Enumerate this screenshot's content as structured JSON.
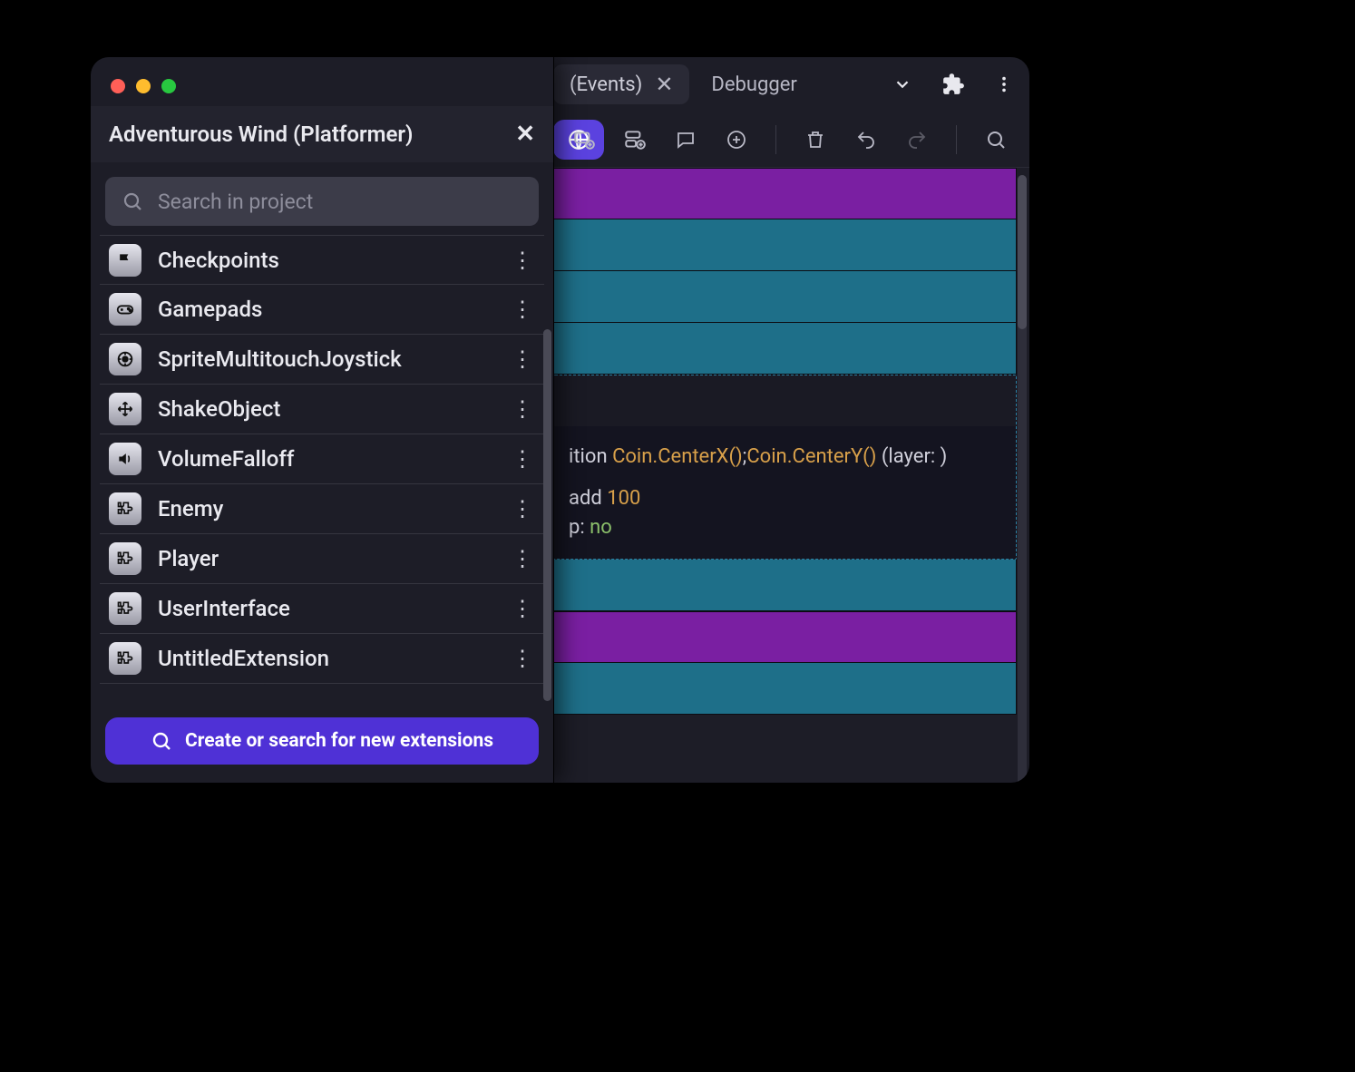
{
  "tabs": {
    "events_label": "(Events)",
    "debugger_label": "Debugger"
  },
  "panel": {
    "title": "Adventurous Wind (Platformer)",
    "search_placeholder": "Search in project",
    "cta_label": "Create or search for new extensions",
    "items": [
      {
        "label": "Checkpoints",
        "icon": "flag-icon"
      },
      {
        "label": "Gamepads",
        "icon": "gamepad-icon"
      },
      {
        "label": "SpriteMultitouchJoystick",
        "icon": "joystick-icon"
      },
      {
        "label": "ShakeObject",
        "icon": "move-icon"
      },
      {
        "label": "VolumeFalloff",
        "icon": "volume-icon"
      },
      {
        "label": "Enemy",
        "icon": "puzzle-icon"
      },
      {
        "label": "Player",
        "icon": "puzzle-icon"
      },
      {
        "label": "UserInterface",
        "icon": "puzzle-icon"
      },
      {
        "label": "UntitledExtension",
        "icon": "puzzle-icon"
      }
    ]
  },
  "event_sheet": {
    "line1_prefix": "ition ",
    "line1_expr1": "Coin.CenterX()",
    "line1_sep": ";",
    "line1_expr2": "Coin.CenterY()",
    "line1_suffix": " (layer: )",
    "line2_prefix": "add ",
    "line2_value": "100",
    "line3_prefix": "p: ",
    "line3_value": "no"
  }
}
